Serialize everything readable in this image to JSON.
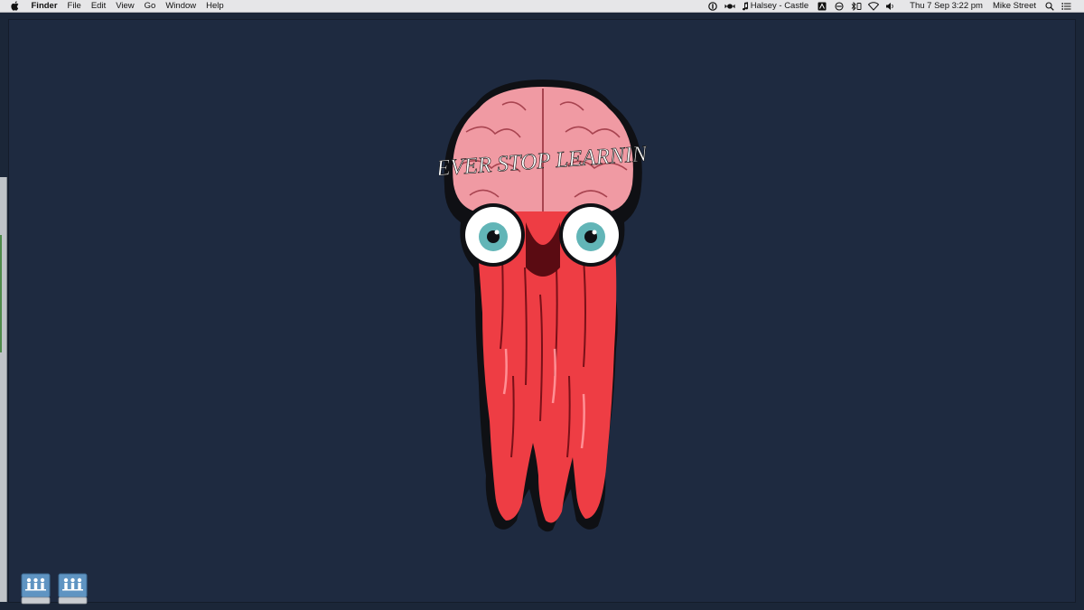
{
  "menubar": {
    "app_name": "Finder",
    "menus": [
      "File",
      "Edit",
      "View",
      "Go",
      "Window",
      "Help"
    ],
    "now_playing": "Halsey - Castle",
    "datetime": "Thu 7 Sep  3:22 pm",
    "user": "Mike Street",
    "tray_icons": [
      "1password-icon",
      "candy-icon",
      "music-note-icon",
      "notes-icon",
      "block-icon",
      "bluetooth-icon",
      "wifi-icon",
      "volume-icon",
      "spotlight-icon",
      "notification-center-icon"
    ]
  },
  "desktop": {
    "wallpaper_text": "NEVER STOP LEARNING",
    "background_color": "#1e2a40",
    "drives": [
      "network-drive-icon",
      "network-drive-icon"
    ]
  },
  "colors": {
    "menubar_bg": "#e6e6e8",
    "brain_pink": "#f09aa3",
    "slime_red": "#ee3d44",
    "iris_teal": "#62b5b7"
  }
}
